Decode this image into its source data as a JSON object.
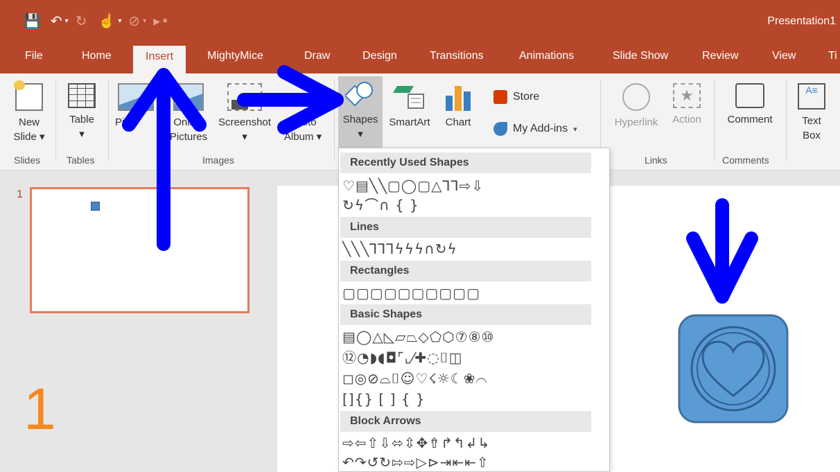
{
  "titlebar": {
    "title": "Presentation1",
    "qat": {
      "save_icon": "save-icon",
      "undo_icon": "undo-icon",
      "redo_icon": "redo-icon"
    }
  },
  "tabs": [
    {
      "label": "File"
    },
    {
      "label": "Home"
    },
    {
      "label": "Insert",
      "active": true
    },
    {
      "label": "MightyMice"
    },
    {
      "label": "Draw"
    },
    {
      "label": "Design"
    },
    {
      "label": "Transitions"
    },
    {
      "label": "Animations"
    },
    {
      "label": "Slide Show"
    },
    {
      "label": "Review"
    },
    {
      "label": "View"
    },
    {
      "label": "Ti"
    }
  ],
  "ribbon": {
    "new_slide": "New\nSlide ▾",
    "table": "Table\n▾",
    "pictures": "Pi",
    "online_pictures": "Online\nPictures",
    "screenshot": "Screenshot\n▾",
    "photo_album": "Photo\nAlbum ▾",
    "shapes": "Shapes\n▾",
    "smartart": "SmartArt",
    "chart": "Chart",
    "store": "Store",
    "my_addins": "My Add-ins",
    "hyperlink": "Hyperlink",
    "action": "Action",
    "comment": "Comment",
    "textbox": "Text\nBox",
    "groups": {
      "slides": "Slides",
      "tables": "Tables",
      "images": "Images",
      "links": "Links",
      "comments": "Comments"
    }
  },
  "dropdown": {
    "sections": [
      {
        "title": "Recently Used Shapes",
        "rows": [
          "♡▤╲╲▢◯▢△⅂⅂⇨⇩",
          "↻ϟ⌒∩ {  }"
        ]
      },
      {
        "title": "Lines",
        "rows": [
          "╲╲╲⅂⅂⅂ϟϟϟ∩↻ϟ"
        ]
      },
      {
        "title": "Rectangles",
        "rows": [
          "▢▢▢▢▢▢▢▢▢▢"
        ]
      },
      {
        "title": "Basic Shapes",
        "rows": [
          "▤◯△◺▱⏢◇⬠⬡⑦⑧⑩",
          "⑫◔◗◖◘⌜⌞⁄✚◌⌷◫",
          "◻◎⊘⌓⌷☺♡☇☼☾❀⌒",
          "[]{} [  ] {  }"
        ]
      },
      {
        "title": "Block Arrows",
        "rows": [
          "⇨⇦⇧⇩⬄⇳✥⇮↱↰↲↳",
          "↶↷↺↻⇰⇨▷⊳⇥⇤⇤⇧"
        ]
      }
    ]
  },
  "slides_pane": {
    "slide_number": "1",
    "big_number": "1"
  },
  "colors": {
    "accent": "#b7472a",
    "arrow": "#0000ff",
    "tile": "#5b9bd5",
    "big_number": "#f5881f"
  }
}
